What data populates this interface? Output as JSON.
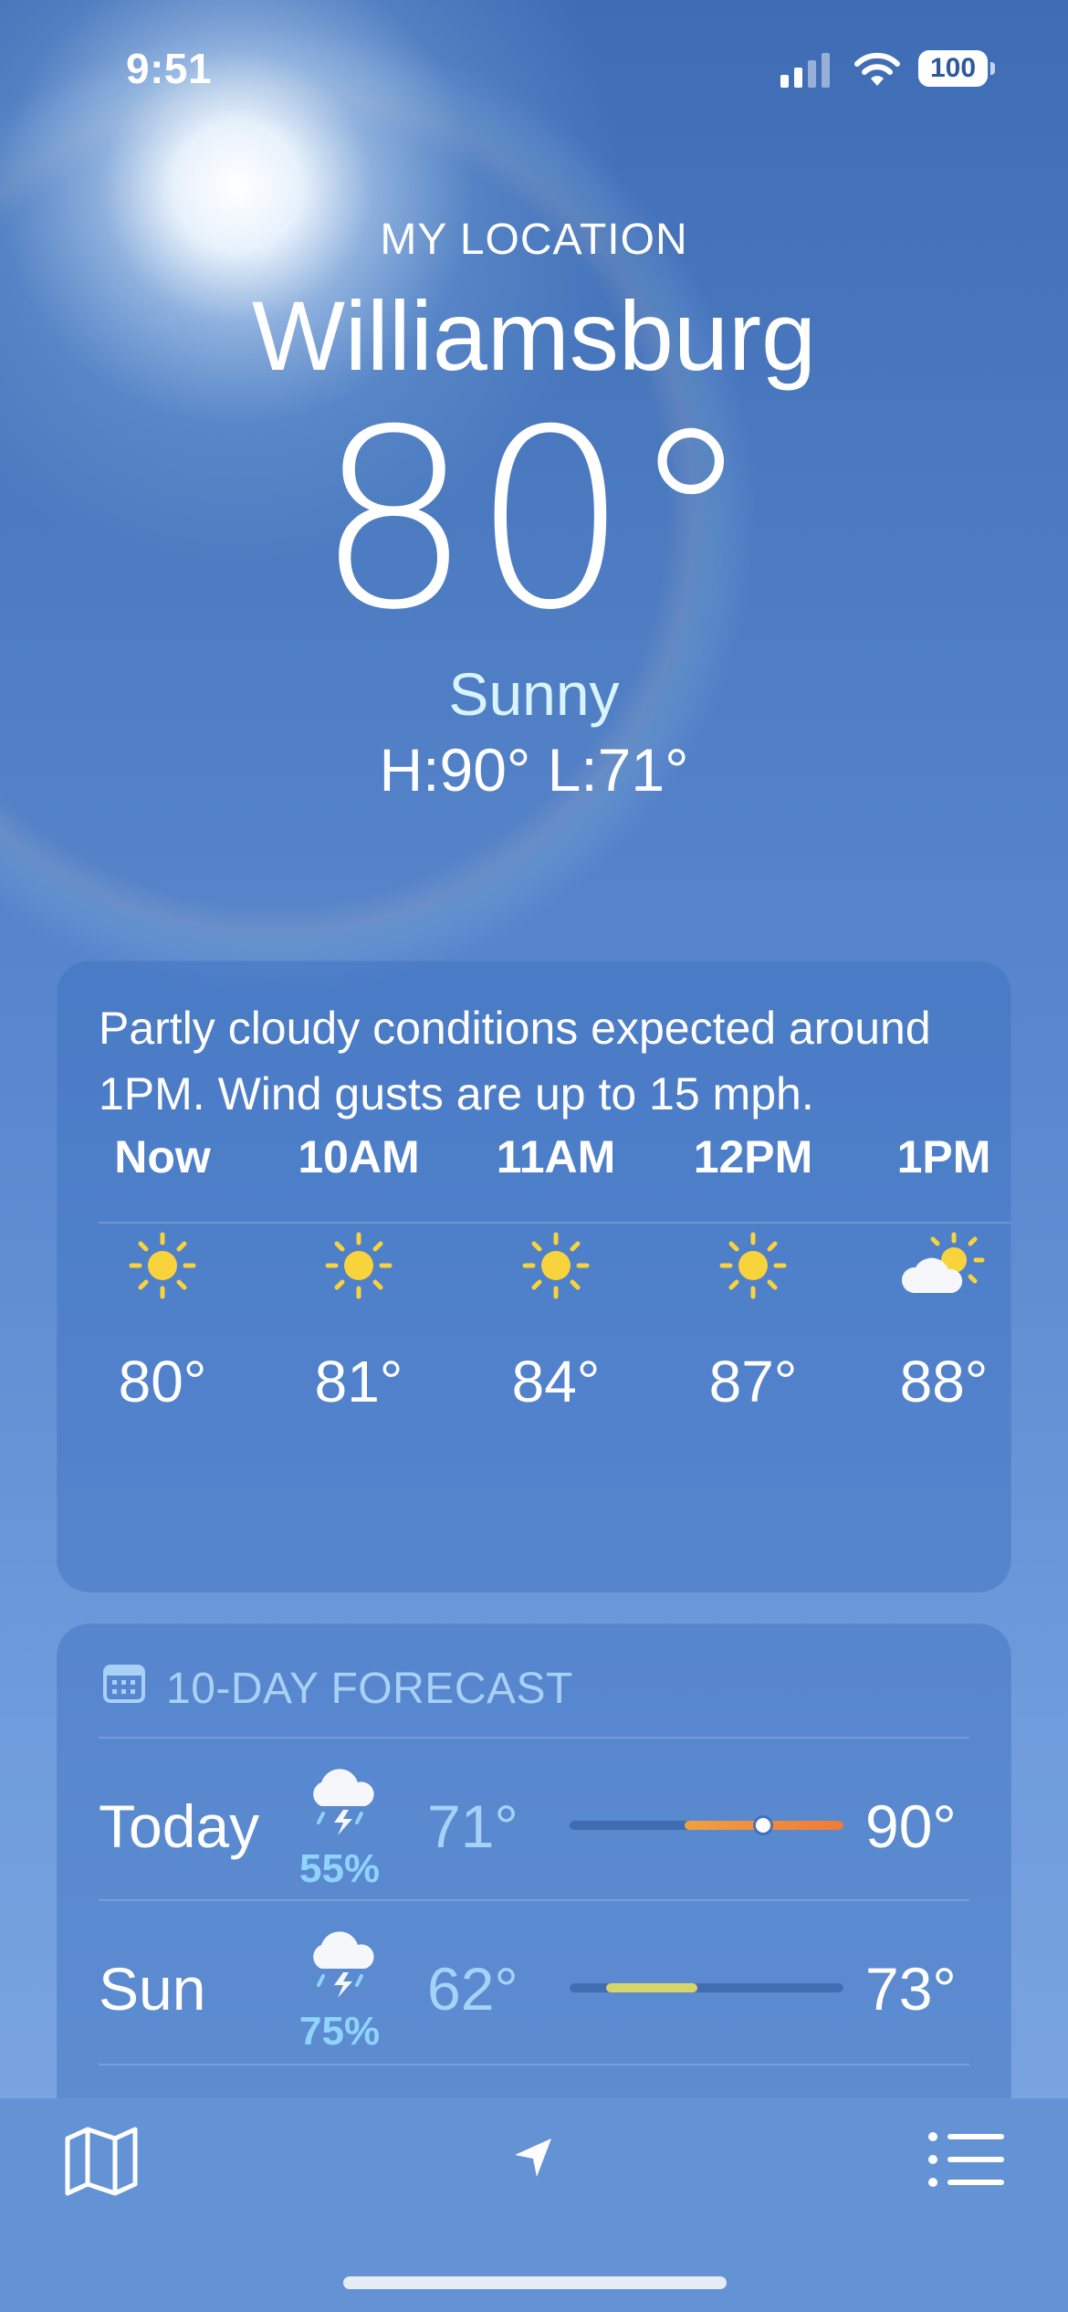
{
  "status": {
    "time": "9:51",
    "battery": "100"
  },
  "header": {
    "location_label": "MY LOCATION",
    "city": "Williamsburg",
    "temperature": "80°",
    "condition": "Sunny",
    "hi_lo": "H:90°  L:71°"
  },
  "summary": {
    "text": "Partly cloudy conditions expected around 1PM. Wind gusts are up to 15 mph."
  },
  "hourly": [
    {
      "label": "Now",
      "icon": "sun-icon",
      "temp": "80°"
    },
    {
      "label": "10AM",
      "icon": "sun-icon",
      "temp": "81°"
    },
    {
      "label": "11AM",
      "icon": "sun-icon",
      "temp": "84°"
    },
    {
      "label": "12PM",
      "icon": "sun-icon",
      "temp": "87°"
    },
    {
      "label": "1PM",
      "icon": "partly-cloudy-icon",
      "temp": "88°"
    }
  ],
  "forecast": {
    "title": "10-DAY FORECAST",
    "days": [
      {
        "day": "Today",
        "icon": "thunderstorm-icon",
        "precip": "55%",
        "low": "71°",
        "high": "90°"
      },
      {
        "day": "Sun",
        "icon": "thunderstorm-icon",
        "precip": "75%",
        "low": "62°",
        "high": "73°"
      }
    ]
  },
  "colors": {
    "sun": "#f8d33c",
    "bar_today": "#f08a3c",
    "bar_sun": "#d7d56a",
    "precip": "#8fd3ff",
    "low_temp": "#a6d2f7"
  },
  "tabbar": {
    "left": "map-icon",
    "center": "location-arrow-icon",
    "right": "list-icon"
  }
}
